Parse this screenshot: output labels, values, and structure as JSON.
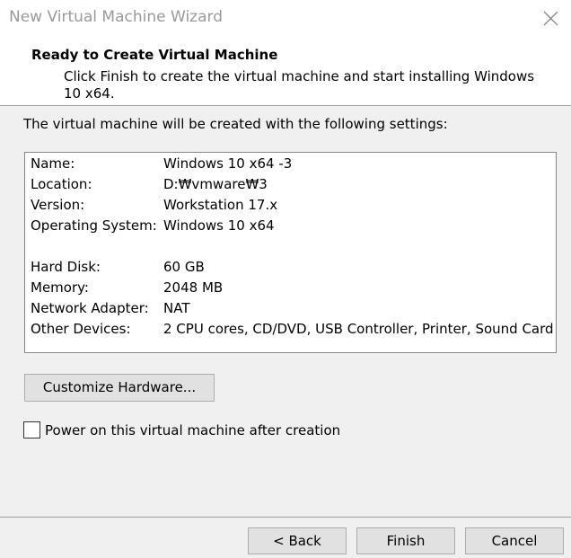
{
  "window": {
    "title": "New Virtual Machine Wizard",
    "close_icon": "close-icon"
  },
  "header": {
    "title": "Ready to Create Virtual Machine",
    "description": "Click Finish to create the virtual machine and start installing Windows 10 x64."
  },
  "intro_text": "The virtual machine will be created with the following settings:",
  "settings": {
    "basic": [
      {
        "label": "Name:",
        "value": "Windows 10 x64 -3"
      },
      {
        "label": "Location:",
        "value": "D:₩vmware₩3"
      },
      {
        "label": "Version:",
        "value": "Workstation 17.x"
      },
      {
        "label": "Operating System:",
        "value": "Windows 10 x64"
      }
    ],
    "hardware": [
      {
        "label": "Hard Disk:",
        "value": "60 GB"
      },
      {
        "label": "Memory:",
        "value": "2048 MB"
      },
      {
        "label": "Network Adapter:",
        "value": "NAT"
      },
      {
        "label": "Other Devices:",
        "value": "2 CPU cores, CD/DVD, USB Controller, Printer, Sound Card"
      }
    ]
  },
  "customize_button": "Customize Hardware...",
  "power_on": {
    "label": "Power on this virtual machine after creation",
    "checked": false
  },
  "footer": {
    "back_label": "< Back",
    "finish_label": "Finish",
    "cancel_label": "Cancel"
  }
}
